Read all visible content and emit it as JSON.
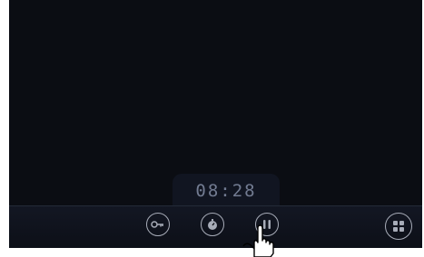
{
  "timer": {
    "display": "08:28"
  },
  "toolbar": {
    "buttons": [
      {
        "name": "key-button",
        "icon": "key-icon"
      },
      {
        "name": "timer-button",
        "icon": "stopwatch-icon"
      },
      {
        "name": "pause-button",
        "icon": "pause-icon"
      },
      {
        "name": "menu-button",
        "icon": "grid-icon"
      }
    ]
  },
  "colors": {
    "background": "#0b0d13",
    "panel": "#131723",
    "icon": "#a7acb8",
    "timer_text": "#727b91"
  }
}
